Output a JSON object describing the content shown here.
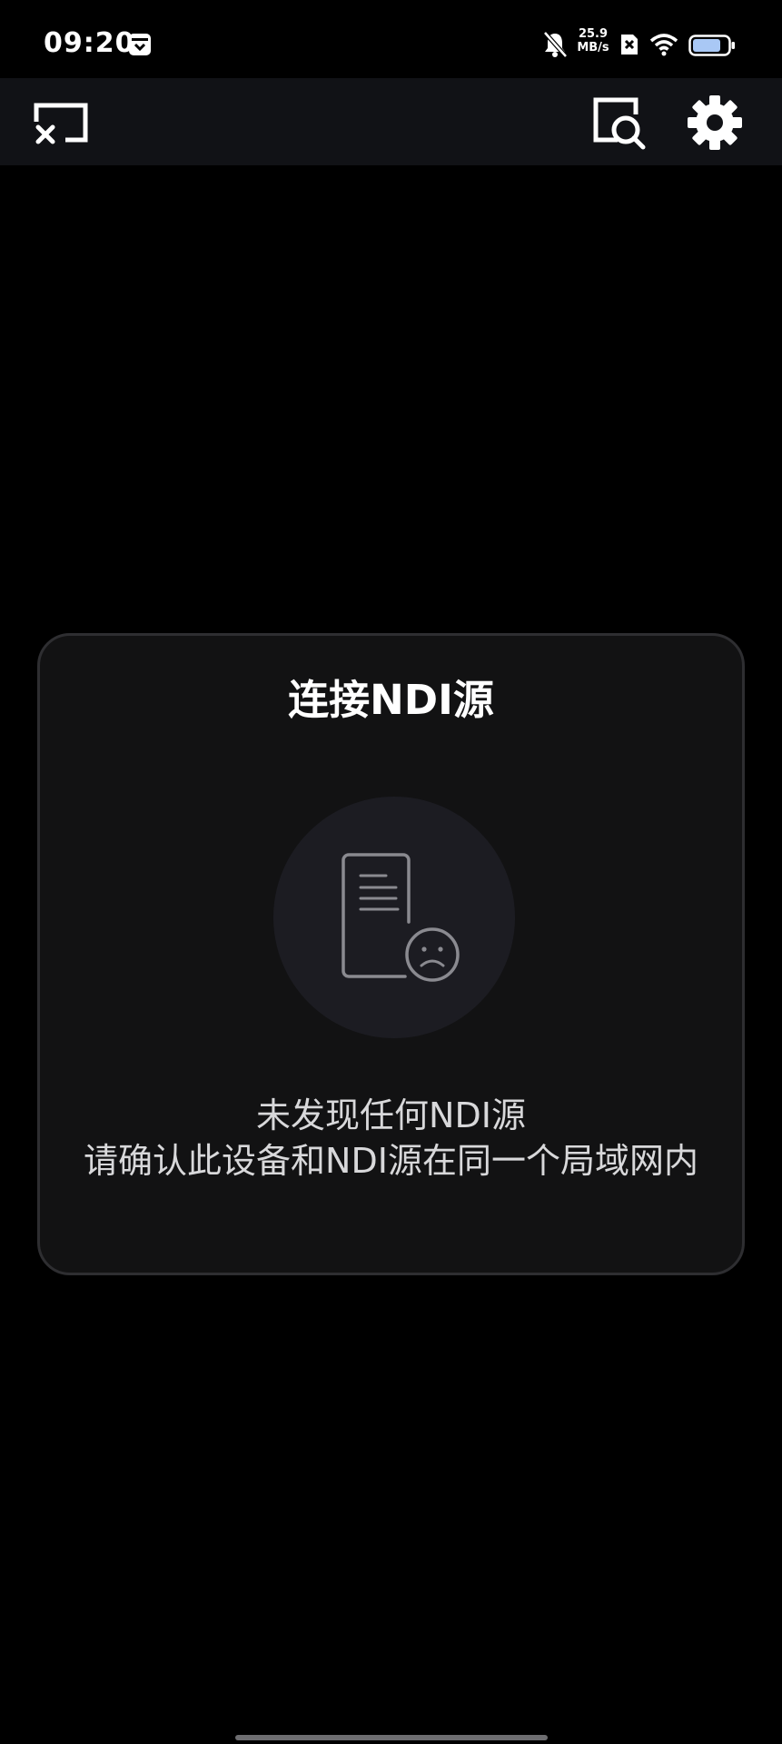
{
  "status_bar": {
    "time": "09:20",
    "net_speed_value": "25.9",
    "net_speed_unit": "MB/s"
  },
  "app_bar": {
    "icons": [
      "cast-off-icon",
      "search-icon",
      "gear-icon"
    ]
  },
  "card": {
    "title": "连接NDI源",
    "illustration_icon": "sad-document-icon",
    "message_line1": "未发现任何NDI源",
    "message_line2": "请确认此设备和NDI源在同一个局域网内"
  },
  "colors": {
    "background": "#000000",
    "app_bar": "#111216",
    "card_background": "#121213",
    "card_border": "#2e2e31",
    "illustration_circle": "#1c1c22",
    "icon_stroke": "#8a8a90",
    "text_primary": "#ffffff",
    "text_secondary": "#d8d8da"
  }
}
